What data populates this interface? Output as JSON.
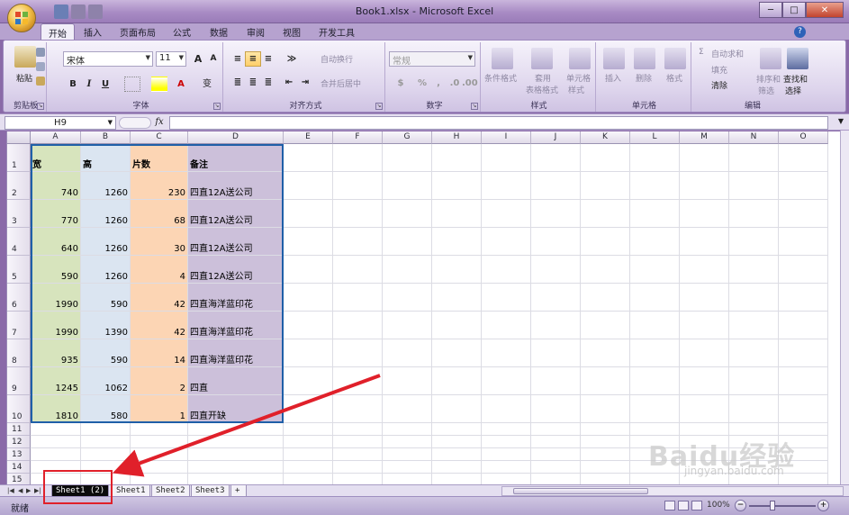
{
  "window": {
    "title": "Book1.xlsx - Microsoft Excel",
    "controls": [
      "─",
      "□",
      "✕"
    ]
  },
  "ribbon_tabs": [
    "开始",
    "插入",
    "页面布局",
    "公式",
    "数据",
    "审阅",
    "视图",
    "开发工具"
  ],
  "active_tab": "开始",
  "clipboard": {
    "paste": "粘贴",
    "label": "剪贴板"
  },
  "font": {
    "name": "宋体",
    "size": "11",
    "label": "字体",
    "bold": "B",
    "italic": "I",
    "underline": "U",
    "grow": "A",
    "shrink": "A",
    "wen": "变"
  },
  "alignment": {
    "wrap": "自动换行",
    "merge": "合并后居中",
    "label": "对齐方式"
  },
  "number": {
    "format": "常规",
    "percent": "%",
    "comma": ",",
    "label": "数字"
  },
  "styles": {
    "cond": "条件格式",
    "table1": "套用",
    "table2": "表格格式",
    "cell1": "单元格",
    "cell2": "样式",
    "label": "样式"
  },
  "cells": {
    "insert": "插入",
    "delete": "删除",
    "format": "格式",
    "label": "单元格"
  },
  "editing": {
    "autosum": "自动求和",
    "fill": "填充",
    "clear": "清除",
    "sort1": "排序和",
    "sort2": "筛选",
    "find1": "查找和",
    "find2": "选择",
    "label": "编辑"
  },
  "formula_bar": {
    "name_box": "H9",
    "fx": "fx",
    "value": ""
  },
  "columns": [
    "A",
    "B",
    "C",
    "D",
    "E",
    "F",
    "G",
    "H",
    "I",
    "J",
    "K",
    "L",
    "M",
    "N",
    "O"
  ],
  "rows": [
    "1",
    "2",
    "3",
    "4",
    "5",
    "6",
    "7",
    "8",
    "9",
    "10",
    "11",
    "12",
    "13",
    "14",
    "15"
  ],
  "table": {
    "headers": [
      "宽",
      "高",
      "片数",
      "备注"
    ],
    "rows": [
      [
        "740",
        "1260",
        "230",
        "四直12A送公司"
      ],
      [
        "770",
        "1260",
        "68",
        "四直12A送公司"
      ],
      [
        "640",
        "1260",
        "30",
        "四直12A送公司"
      ],
      [
        "590",
        "1260",
        "4",
        "四直12A送公司"
      ],
      [
        "1990",
        "590",
        "42",
        "四直海洋蓝印花"
      ],
      [
        "1990",
        "1390",
        "42",
        "四直海洋蓝印花"
      ],
      [
        "935",
        "590",
        "14",
        "四直海洋蓝印花"
      ],
      [
        "1245",
        "1062",
        "2",
        "四直"
      ],
      [
        "1810",
        "580",
        "1",
        "四直开缺"
      ]
    ],
    "colors": {
      "A": "#d7e4bd",
      "B": "#dbe5f1",
      "C": "#fcd5b4",
      "D": "#ccc0da",
      "border": "#1f5fa8"
    }
  },
  "sheets": [
    "Sheet1 (2)",
    "Sheet1",
    "Sheet2",
    "Sheet3"
  ],
  "active_sheet": "Sheet1 (2)",
  "status": {
    "text": "就绪",
    "zoom": "100%",
    "zoom_out": "−",
    "zoom_in": "+"
  },
  "watermark": {
    "main": "Baidu经验",
    "sub": "jingyan.baidu.com"
  },
  "annotation": {
    "color": "#e0202a"
  }
}
